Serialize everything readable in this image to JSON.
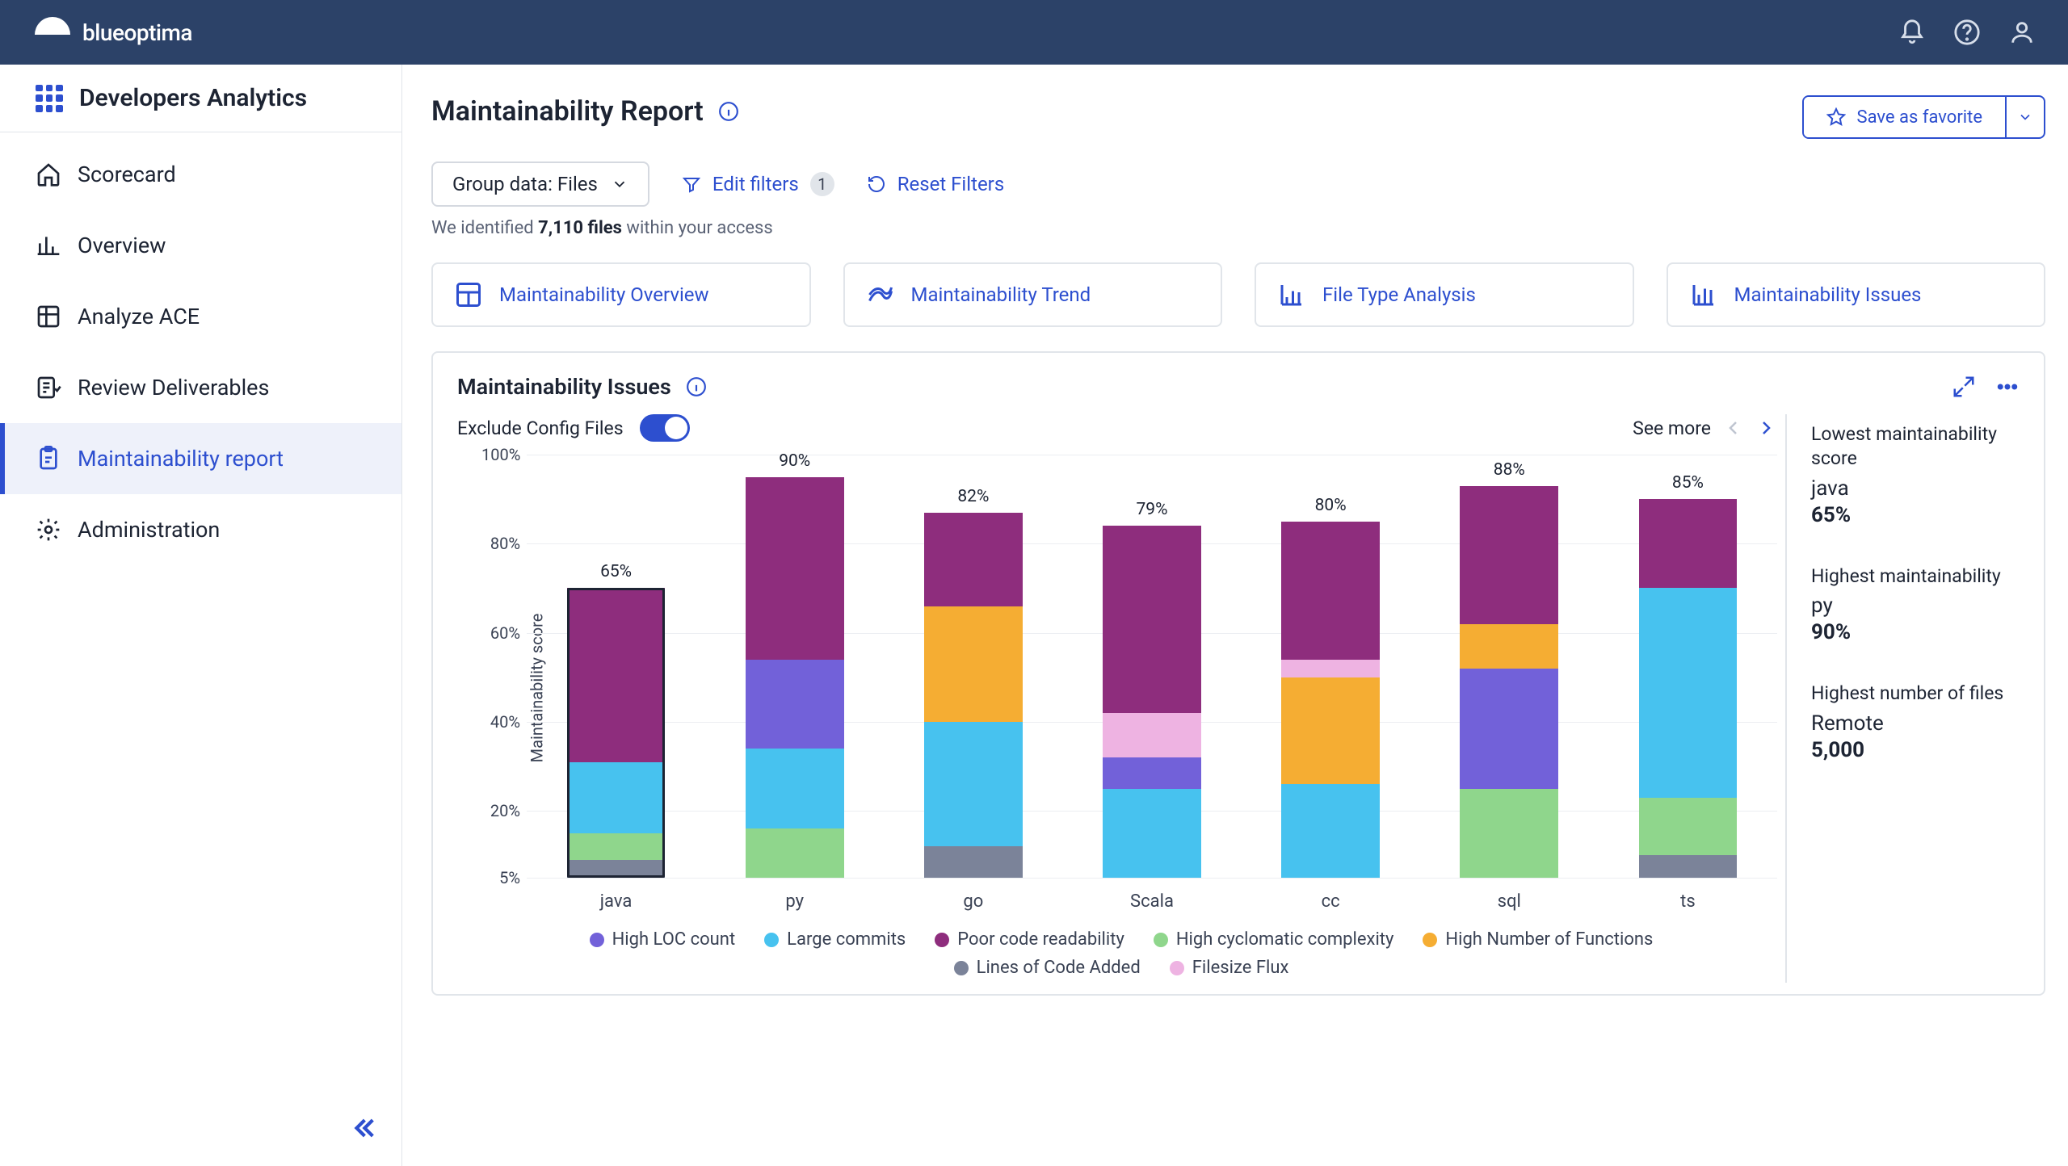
{
  "brand": "blueoptima",
  "sidebar": {
    "title": "Developers Analytics",
    "items": [
      {
        "label": "Scorecard"
      },
      {
        "label": "Overview"
      },
      {
        "label": "Analyze ACE"
      },
      {
        "label": "Review Deliverables"
      },
      {
        "label": "Maintainability report"
      },
      {
        "label": "Administration"
      }
    ]
  },
  "page": {
    "title": "Maintainability Report",
    "save_favorite": "Save as favorite",
    "group_data_label": "Group data: Files",
    "edit_filters": "Edit filters",
    "filter_count": "1",
    "reset_filters": "Reset Filters",
    "identified_prefix": "We identified ",
    "identified_count": "7,110 files",
    "identified_suffix": " within your access"
  },
  "tabs": [
    {
      "label": "Maintainability Overview"
    },
    {
      "label": "Maintainability Trend"
    },
    {
      "label": "File Type Analysis"
    },
    {
      "label": "Maintainability Issues"
    }
  ],
  "panel": {
    "title": "Maintainability Issues",
    "exclude_label": "Exclude Config Files",
    "see_more": "See more"
  },
  "chart_data": {
    "type": "bar",
    "ylabel": "Maintainability score",
    "ylim": [
      5,
      100
    ],
    "yticks": [
      "5%",
      "20%",
      "40%",
      "60%",
      "80%",
      "100%"
    ],
    "categories": [
      "java",
      "py",
      "go",
      "Scala",
      "cc",
      "sql",
      "ts"
    ],
    "totals": [
      "65%",
      "90%",
      "82%",
      "79%",
      "80%",
      "88%",
      "85%"
    ],
    "legend": [
      {
        "key": "loc",
        "label": "High LOC count"
      },
      {
        "key": "large",
        "label": "Large commits"
      },
      {
        "key": "read",
        "label": "Poor code readability"
      },
      {
        "key": "cyclo",
        "label": "High cyclomatic complexity"
      },
      {
        "key": "func",
        "label": "High Number of Functions"
      },
      {
        "key": "lines",
        "label": "Lines of Code Added"
      },
      {
        "key": "flux",
        "label": "Filesize Flux"
      }
    ],
    "series_keys": [
      "lines",
      "cyclo",
      "large",
      "loc",
      "func",
      "flux",
      "read"
    ],
    "stacks": [
      {
        "cat": "java",
        "outlined": true,
        "segs": {
          "lines": 4,
          "cyclo": 6,
          "large": 16,
          "loc": 0,
          "func": 0,
          "flux": 0,
          "read": 39
        }
      },
      {
        "cat": "py",
        "outlined": false,
        "segs": {
          "lines": 0,
          "cyclo": 11,
          "large": 18,
          "loc": 20,
          "func": 0,
          "flux": 0,
          "read": 41
        }
      },
      {
        "cat": "go",
        "outlined": false,
        "segs": {
          "lines": 7,
          "cyclo": 0,
          "large": 28,
          "loc": 0,
          "func": 26,
          "flux": 0,
          "read": 21
        }
      },
      {
        "cat": "Scala",
        "outlined": false,
        "segs": {
          "lines": 0,
          "cyclo": 0,
          "large": 20,
          "loc": 7,
          "func": 0,
          "flux": 10,
          "read": 42
        }
      },
      {
        "cat": "cc",
        "outlined": false,
        "segs": {
          "lines": 0,
          "cyclo": 0,
          "large": 21,
          "loc": 0,
          "func": 24,
          "flux": 4,
          "read": 31
        }
      },
      {
        "cat": "sql",
        "outlined": false,
        "segs": {
          "lines": 0,
          "cyclo": 20,
          "large": 0,
          "loc": 27,
          "func": 10,
          "flux": 0,
          "read": 31
        }
      },
      {
        "cat": "ts",
        "outlined": false,
        "segs": {
          "lines": 5,
          "cyclo": 13,
          "large": 47,
          "loc": 0,
          "func": 0,
          "flux": 0,
          "read": 20
        }
      }
    ]
  },
  "stats": {
    "lowest": {
      "label": "Lowest maintainability score",
      "name": "java",
      "value": "65%"
    },
    "highest": {
      "label": "Highest maintainability",
      "name": "py",
      "value": "90%"
    },
    "files": {
      "label": "Highest number of files",
      "name": "Remote",
      "value": "5,000"
    }
  }
}
